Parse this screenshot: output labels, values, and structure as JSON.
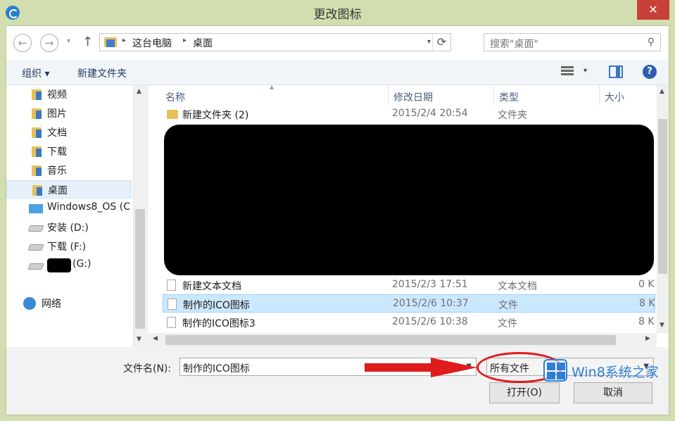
{
  "window": {
    "title": "更改图标",
    "close_glyph": "✕"
  },
  "nav": {
    "back_glyph": "←",
    "forward_glyph": "→",
    "dropdown_glyph": "▾",
    "up_glyph": "↑",
    "breadcrumb": [
      "这台电脑",
      "桌面"
    ],
    "breadcrumb_sep": "▸",
    "refresh_glyph": "⟳",
    "search_placeholder": "搜索\"桌面\"",
    "search_glyph": "⚲"
  },
  "toolbar": {
    "organize": "组织 ▾",
    "new_folder": "新建文件夹",
    "help_glyph": "?",
    "view_drop": "▾"
  },
  "sidebar": {
    "items": [
      {
        "label": "视频",
        "icon": "video-folder-icon"
      },
      {
        "label": "图片",
        "icon": "pictures-folder-icon"
      },
      {
        "label": "文档",
        "icon": "documents-folder-icon"
      },
      {
        "label": "下载",
        "icon": "downloads-folder-icon"
      },
      {
        "label": "音乐",
        "icon": "music-folder-icon"
      },
      {
        "label": "桌面",
        "icon": "desktop-folder-icon",
        "selected": true
      },
      {
        "label": "Windows8_OS (C",
        "icon": "windows-drive-icon"
      },
      {
        "label": "安装 (D:)",
        "icon": "drive-icon"
      },
      {
        "label": "下载 (F:)",
        "icon": "drive-icon"
      },
      {
        "label": "(G:)",
        "icon": "drive-icon",
        "redacted": true
      },
      {
        "label": "网络",
        "icon": "network-icon"
      }
    ]
  },
  "columns": {
    "name": "名称",
    "date": "修改日期",
    "type": "类型",
    "size": "大小"
  },
  "files": [
    {
      "name": "新建文件夹 (2)",
      "date": "2015/2/4 20:54",
      "type": "文件夹",
      "size": "",
      "kind": "folder"
    },
    {
      "name": "新建文本文档",
      "date": "2015/2/3 17:51",
      "type": "文本文档",
      "size": "0 K",
      "kind": "file"
    },
    {
      "name": "制作的ICO图标",
      "date": "2015/2/6 10:37",
      "type": "文件",
      "size": "8 K",
      "kind": "file",
      "selected": true
    },
    {
      "name": "制作的ICO图标3",
      "date": "2015/2/6 10:38",
      "type": "文件",
      "size": "8 K",
      "kind": "file"
    }
  ],
  "footer": {
    "filename_label": "文件名(N):",
    "filename_value": "制作的ICO图标",
    "filetype_value": "所有文件",
    "open_button": "打开(O)",
    "cancel_button": "取消"
  },
  "watermark": {
    "text": "Win8系统之家"
  },
  "colors": {
    "annotation_red": "#e01b1b",
    "selection": "#cce8ff",
    "titlebar": "#d2deb0"
  }
}
